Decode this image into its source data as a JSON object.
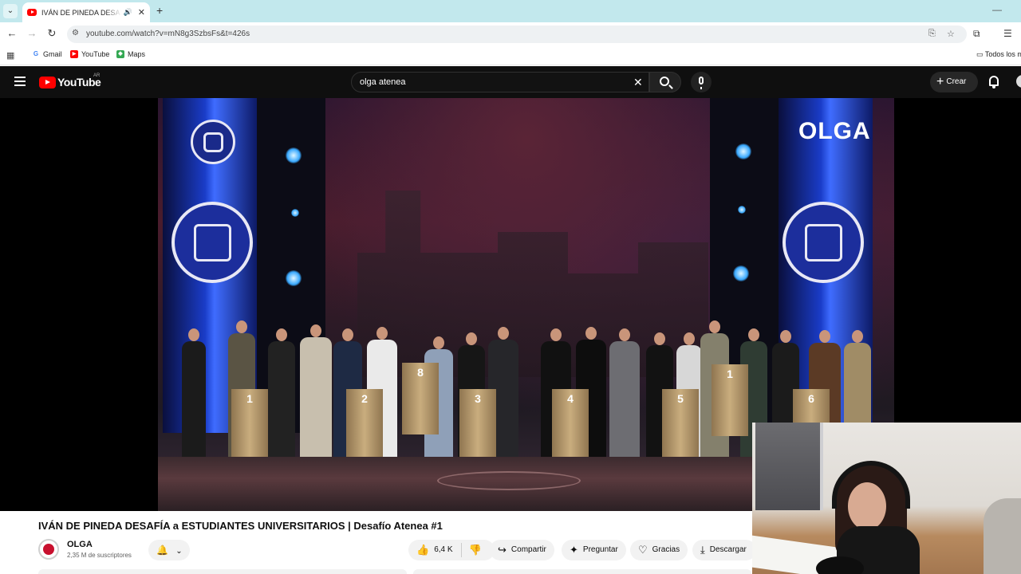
{
  "browser": {
    "tab_title": "IVÁN DE PINEDA DESAFÍA a ESTUDIANTES UNIVERSITARIOS | Desafío Atenea #1",
    "url": "youtube.com/watch?v=mN8g3SzbsFs&t=426s",
    "bookmarks": [
      "Gmail",
      "YouTube",
      "Maps"
    ],
    "bookmarks_right": "Todos los m"
  },
  "youtube": {
    "region": "AR",
    "logo_text": "YouTube",
    "search_query": "olga atenea",
    "create_label": "Crear"
  },
  "video": {
    "overlay_brand": "OLGA",
    "podium_numbers": [
      "1",
      "2",
      "8",
      "3",
      "4",
      "5",
      "1",
      "6"
    ],
    "title": "IVÁN DE PINEDA DESAFÍA a ESTUDIANTES UNIVERSITARIOS | Desafío Atenea #1"
  },
  "channel": {
    "name": "OLGA",
    "subscribers": "2,35 M de suscriptores"
  },
  "actions": {
    "likes": "6,4 K",
    "share": "Compartir",
    "ask": "Preguntar",
    "thanks": "Gracias",
    "download": "Descargar"
  },
  "colors": {
    "yt_header": "#0f0f0f",
    "yt_red": "#ff0000",
    "tabstrip": "#c2e8ed",
    "curtain_blue": "#1a3cc8"
  }
}
